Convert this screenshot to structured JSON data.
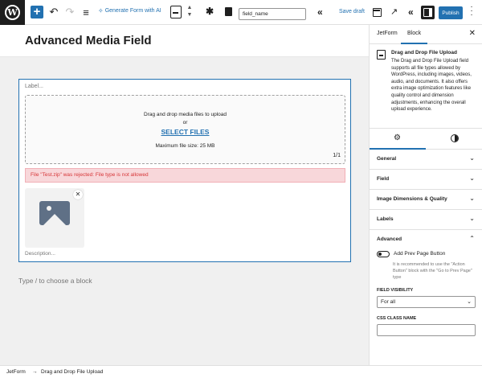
{
  "toolbar": {
    "generate_form_label": "Generate Form with AI",
    "field_name_value": "field_name",
    "save_draft_label": "Save draft",
    "publish_label": "Publish"
  },
  "editor": {
    "page_title": "Advanced Media Field",
    "label_placeholder": "Label...",
    "dropzone_text": "Drag and drop media files to upload",
    "dropzone_or": "or",
    "select_files_label": "SELECT FILES",
    "max_file_size": "Maximum file size: 25 MB",
    "file_count": "1/1",
    "error_message": "File \"Test.zip\" was rejected: File type is not allowed",
    "description_placeholder": "Description...",
    "appender_placeholder": "Type / to choose a block"
  },
  "sidebar": {
    "tabs": [
      "JetForm",
      "Block"
    ],
    "active_tab": "Block",
    "block_title": "Drag and Drop File Upload",
    "block_description": "The Drag and Drop File Upload field supports all file types allowed by WordPress, including images, videos, audio, and documents. It also offers extra image optimization features like quality control and dimension adjustments, enhancing the overall upload experience.",
    "panels": [
      "General",
      "Field",
      "Image Dimensions & Quality",
      "Labels",
      "Advanced"
    ],
    "advanced": {
      "toggle_label": "Add Prev Page Button",
      "toggle_on": false,
      "help_text": "It is recommended to use the \"Action Button\" block with the \"Go to Prev Page\" type",
      "visibility_label": "FIELD VISIBILITY",
      "visibility_value": "For all",
      "css_class_label": "CSS CLASS NAME",
      "css_class_value": ""
    }
  },
  "breadcrumb": [
    "JetForm",
    "Drag and Drop File Upload"
  ],
  "colors": {
    "accent": "#2271b1",
    "error_bg": "#f8d7da",
    "error_text": "#d63638"
  }
}
